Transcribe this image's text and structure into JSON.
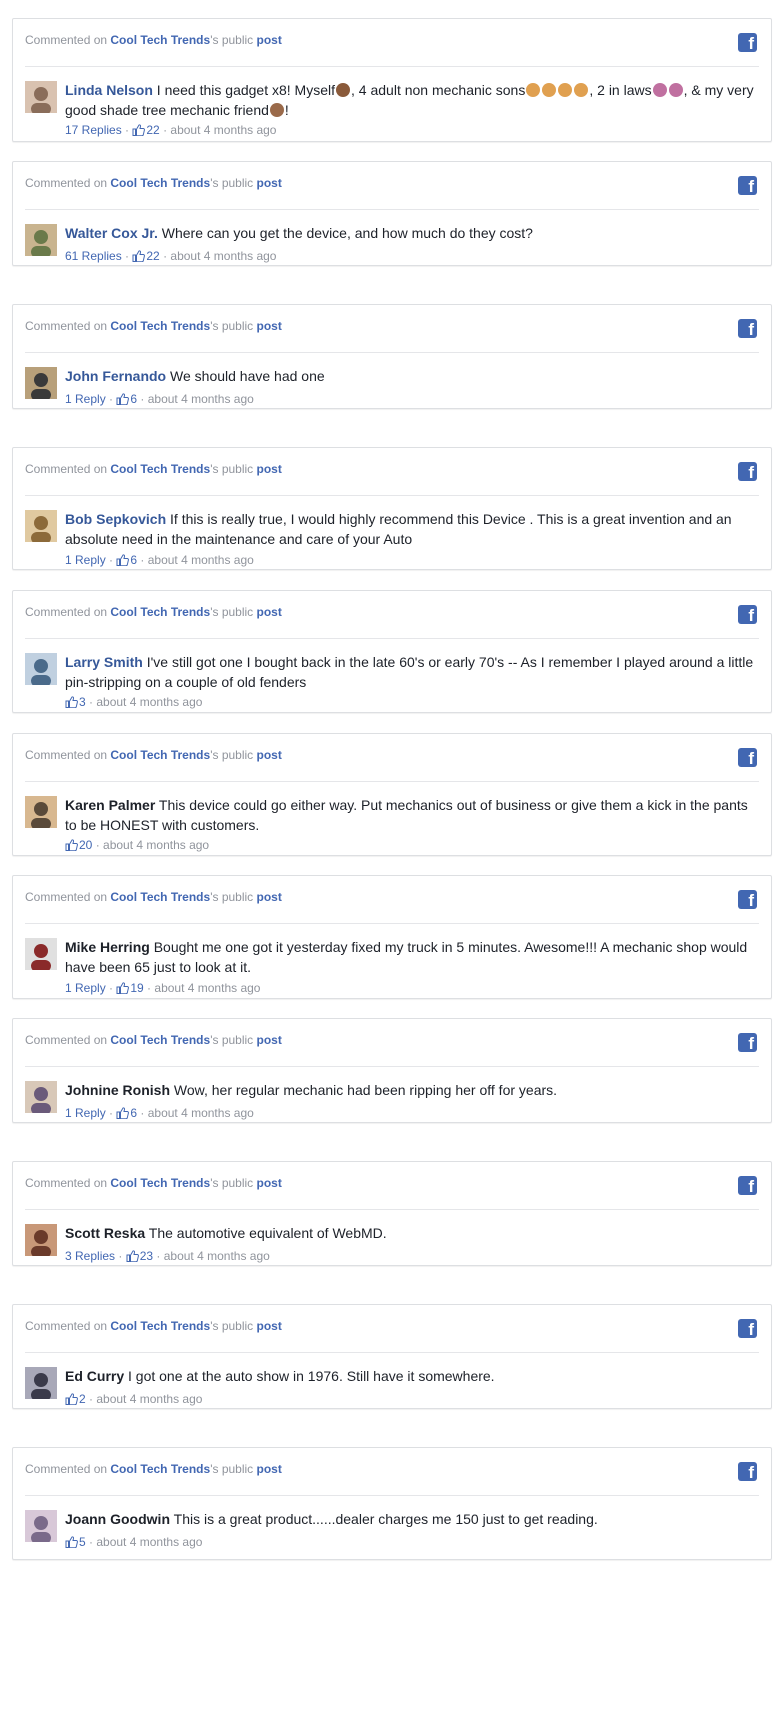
{
  "header": {
    "prefix": "Commented on",
    "page_name": "Cool Tech Trends",
    "suffix": "'s public",
    "post_link": "post"
  },
  "icons": {
    "platform": "facebook-icon",
    "like": "thumbs-up-icon"
  },
  "colors": {
    "link": "#4267b2",
    "name_link": "#365899",
    "muted": "#90949c",
    "border": "#dddfe2"
  },
  "comments": [
    {
      "author": "Linda Nelson",
      "name_style": "link",
      "text": "I need this gadget x8! Myself",
      "text_parts": [
        "I need this gadget x8! Myself",
        ", 4 adult non mechanic sons",
        ", 2 in laws",
        ", & my very good shade tree mechanic friend",
        "!"
      ],
      "replies": "17 Replies",
      "likes": "22",
      "time": "about 4 months ago"
    },
    {
      "author": "Walter Cox Jr.",
      "name_style": "link",
      "text": "Where can you get the device, and how much do they cost?",
      "replies": "61 Replies",
      "likes": "22",
      "time": "about 4 months ago"
    },
    {
      "author": "John Fernando",
      "name_style": "link",
      "text": "We should have had one",
      "replies": "1 Reply",
      "likes": "6",
      "time": "about 4 months ago"
    },
    {
      "author": "Bob Sepkovich",
      "name_style": "link",
      "text": "If this is really true, I would highly recommend this Device . This is a great invention and an absolute need in the maintenance and care of your Auto",
      "replies": "1 Reply",
      "likes": "6",
      "time": "about 4 months ago"
    },
    {
      "author": "Larry Smith",
      "name_style": "link",
      "text": "I've still got one I bought back in the late 60's or early 70's -- As I remember I played around a little pin-stripping on a couple of old fenders",
      "replies": "",
      "likes": "3",
      "time": "about 4 months ago"
    },
    {
      "author": "Karen Palmer",
      "name_style": "dark",
      "text": "This device could go either way. Put mechanics out of business or give them a kick in the pants to be HONEST with customers.",
      "replies": "",
      "likes": "20",
      "time": "about 4 months ago"
    },
    {
      "author": "Mike Herring",
      "name_style": "dark",
      "text": "Bought me one got it yesterday fixed my truck in 5 minutes. Awesome!!! A mechanic shop would have been 65 just to look at it.",
      "replies": "1 Reply",
      "likes": "19",
      "time": "about 4 months ago"
    },
    {
      "author": "Johnine Ronish",
      "name_style": "dark",
      "text": "Wow, her regular mechanic had been ripping her off for years.",
      "replies": "1 Reply",
      "likes": "6",
      "time": "about 4 months ago"
    },
    {
      "author": "Scott Reska",
      "name_style": "dark",
      "text": "The automotive equivalent of WebMD.",
      "replies": "3 Replies",
      "likes": "23",
      "time": "about 4 months ago"
    },
    {
      "author": "Ed Curry",
      "name_style": "dark",
      "text": "I got one at the auto show in 1976. Still have it somewhere.",
      "replies": "",
      "likes": "2",
      "time": "about 4 months ago"
    },
    {
      "author": "Joann Goodwin",
      "name_style": "dark",
      "text": "This is a great product......dealer charges me 150 just to get reading.",
      "replies": "",
      "likes": "5",
      "time": "about 4 months ago"
    }
  ]
}
